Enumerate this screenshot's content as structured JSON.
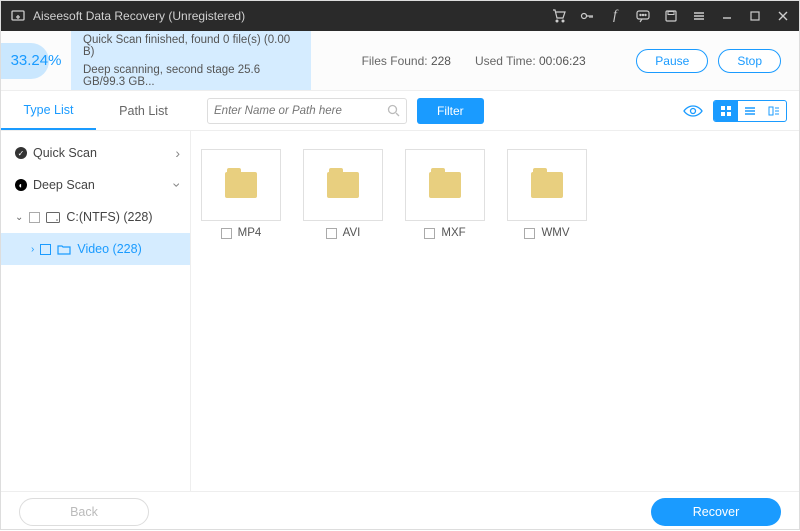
{
  "titlebar": {
    "title": "Aiseesoft Data Recovery (Unregistered)"
  },
  "status": {
    "progress_percent": "33.24%",
    "line1": "Quick Scan finished, found 0 file(s) (0.00  B)",
    "line2": "Deep scanning, second stage 25.6 GB/99.3 GB...",
    "files_found_label": "Files Found:",
    "files_found": "228",
    "used_time_label": "Used Time:",
    "used_time": "00:06:23",
    "pause": "Pause",
    "stop": "Stop"
  },
  "tabs": {
    "type_list": "Type List",
    "path_list": "Path List"
  },
  "search": {
    "placeholder": "Enter Name or Path here"
  },
  "filter": "Filter",
  "tree": {
    "quick_scan": "Quick Scan",
    "deep_scan": "Deep Scan",
    "drive": "C:(NTFS) (228)",
    "video": "Video (228)"
  },
  "folders": [
    "MP4",
    "AVI",
    "MXF",
    "WMV"
  ],
  "footer": {
    "back": "Back",
    "recover": "Recover"
  }
}
